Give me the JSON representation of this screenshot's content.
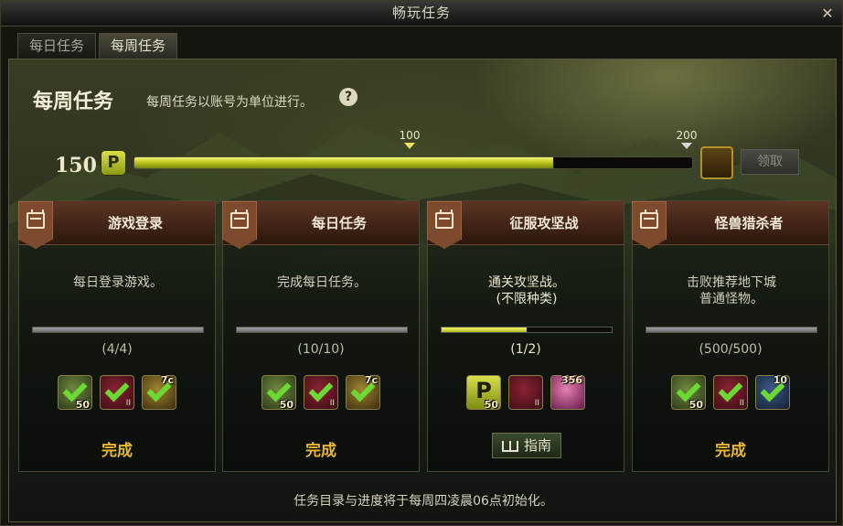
{
  "window": {
    "title": "畅玩任务"
  },
  "tabs": [
    {
      "label": "每日任务",
      "active": false
    },
    {
      "label": "每周任务",
      "active": true
    }
  ],
  "header": {
    "title": "每周任务",
    "subtitle": "每周任务以账号为单位进行。",
    "help": "?"
  },
  "progress": {
    "points": "150",
    "points_icon": "P",
    "value": 150,
    "max": 200,
    "markers": [
      "100",
      "200"
    ],
    "claim_label": "领取",
    "claim_enabled": false
  },
  "cards": [
    {
      "title": "游戏登录",
      "desc": "每日登录游戏。",
      "progress": 1.0,
      "count": "(4/4)",
      "rewards": [
        {
          "icon": "gem-reward-icon",
          "qty": "50",
          "claimed": true
        },
        {
          "icon": "red-crystal-reward-icon",
          "grade": "II",
          "claimed": true
        },
        {
          "icon": "gold-ticket-reward-icon",
          "tag": "7c",
          "claimed": true
        }
      ],
      "status": "完成"
    },
    {
      "title": "每日任务",
      "desc": "完成每日任务。",
      "progress": 1.0,
      "count": "(10/10)",
      "rewards": [
        {
          "icon": "gem-reward-icon",
          "qty": "50",
          "claimed": true
        },
        {
          "icon": "red-crystal-reward-icon",
          "grade": "II",
          "claimed": true
        },
        {
          "icon": "gold-ticket-reward-icon",
          "tag": "7c",
          "claimed": true
        }
      ],
      "status": "完成"
    },
    {
      "title": "征服攻坚战",
      "desc": "通关攻坚战。\n(不限种类)",
      "progress": 0.5,
      "count": "(1/2)",
      "rewards": [
        {
          "icon": "p-point-reward-icon",
          "qty": "50",
          "claimed": false
        },
        {
          "icon": "red-crystal-reward-icon",
          "grade": "II",
          "claimed": false
        },
        {
          "icon": "pink-crystal-reward-icon",
          "tag": "356",
          "claimed": false
        }
      ],
      "guide_label": "指南"
    },
    {
      "title": "怪兽猎杀者",
      "desc": "击败推荐地下城\n普通怪物。",
      "progress": 1.0,
      "count": "(500/500)",
      "rewards": [
        {
          "icon": "gem-reward-icon",
          "qty": "50",
          "claimed": true
        },
        {
          "icon": "red-crystal-reward-icon",
          "grade": "II",
          "claimed": true
        },
        {
          "icon": "blue-ticket-reward-icon",
          "tag": "10",
          "claimed": true
        }
      ],
      "status": "完成"
    }
  ],
  "footer": "任务目录与进度将于每周四凌晨06点初始化。"
}
